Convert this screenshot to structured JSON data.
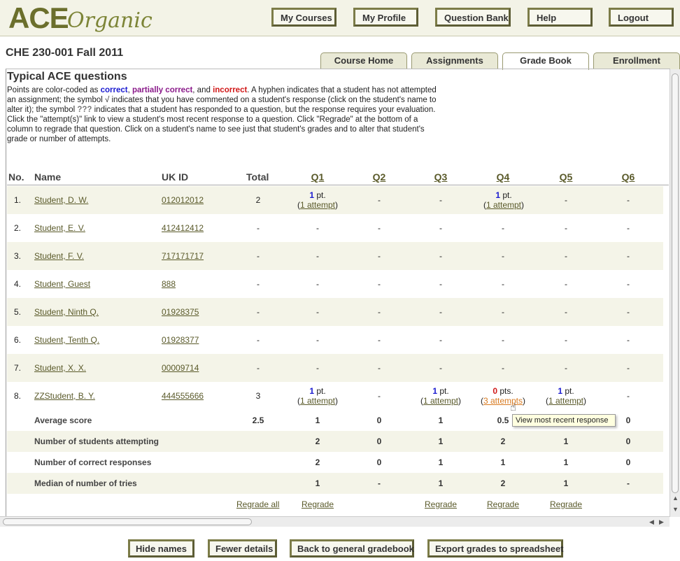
{
  "app": {
    "logo_main": "ACE",
    "logo_sub": "Organic"
  },
  "nav": {
    "my_courses": "My Courses",
    "my_profile": "My Profile",
    "question_bank": "Question Bank",
    "help": "Help",
    "logout": "Logout"
  },
  "course": {
    "title": "CHE 230-001 Fall 2011"
  },
  "tabs": {
    "course_home": "Course Home",
    "assignments": "Assignments",
    "grade_book": "Grade Book",
    "enrollment": "Enrollment"
  },
  "page": {
    "heading": "Typical ACE questions",
    "intro_1": "Points are color-coded as ",
    "correct": "correct",
    "comma": ", ",
    "partial": "partially correct",
    "and": ", and ",
    "incorrect": "incorrect",
    "intro_2": ". A hyphen indicates that a student has not attempted an assignment; the symbol √ indicates that you have commented on a student's response (click on the student's name to alter it); the symbol ",
    "qqq": "???",
    "intro_3": " indicates that a student has responded to a question, but the response requires your evaluation. Click the \"attempt(s)\" link to view a student's most recent response to a question. Click \"Regrade\" at the bottom of a column to regrade that question. Click on a student's name to see just that student's grades and to alter that student's grade or number of attempts."
  },
  "table": {
    "headers": {
      "no": "No.",
      "name": "Name",
      "ukid": "UK ID",
      "total": "Total",
      "q1": "Q1",
      "q2": "Q2",
      "q3": "Q3",
      "q4": "Q4",
      "q5": "Q5",
      "q6": "Q6"
    },
    "rows": [
      {
        "no": "1.",
        "name": "Student, D. W.",
        "ukid": "012012012",
        "total": "2",
        "q1_pts": "1",
        "q1_unit": " pt.",
        "q1_att": "1 attempt",
        "q2": "-",
        "q3": "-",
        "q4_pts": "1",
        "q4_unit": " pt.",
        "q4_att": "1 attempt",
        "q5": "-",
        "q6": "-"
      },
      {
        "no": "2.",
        "name": "Student, E. V.",
        "ukid": "412412412",
        "total": "-",
        "q1": "-",
        "q2": "-",
        "q3": "-",
        "q4": "-",
        "q5": "-",
        "q6": "-"
      },
      {
        "no": "3.",
        "name": "Student, F. V.",
        "ukid": "717171717",
        "total": "-",
        "q1": "-",
        "q2": "-",
        "q3": "-",
        "q4": "-",
        "q5": "-",
        "q6": "-"
      },
      {
        "no": "4.",
        "name": "Student, Guest",
        "ukid": "888",
        "total": "-",
        "q1": "-",
        "q2": "-",
        "q3": "-",
        "q4": "-",
        "q5": "-",
        "q6": "-"
      },
      {
        "no": "5.",
        "name": "Student, Ninth Q.",
        "ukid": "01928375",
        "total": "-",
        "q1": "-",
        "q2": "-",
        "q3": "-",
        "q4": "-",
        "q5": "-",
        "q6": "-"
      },
      {
        "no": "6.",
        "name": "Student, Tenth Q.",
        "ukid": "01928377",
        "total": "-",
        "q1": "-",
        "q2": "-",
        "q3": "-",
        "q4": "-",
        "q5": "-",
        "q6": "-"
      },
      {
        "no": "7.",
        "name": "Student, X. X.",
        "ukid": "00009714",
        "total": "-",
        "q1": "-",
        "q2": "-",
        "q3": "-",
        "q4": "-",
        "q5": "-",
        "q6": "-"
      },
      {
        "no": "8.",
        "name": "ZZStudent, B. Y.",
        "ukid": "444555666",
        "total": "3",
        "q1_pts": "1",
        "q1_unit": " pt.",
        "q1_att": "1 attempt",
        "q2": "-",
        "q3_pts": "1",
        "q3_unit": " pt.",
        "q3_att": "1 attempt",
        "q4_pts": "0",
        "q4_unit": " pts.",
        "q4_att": "3 attempts",
        "q5_pts": "1",
        "q5_unit": " pt.",
        "q5_att": "1 attempt",
        "q6": "-"
      }
    ],
    "stats": [
      {
        "label": "Average score",
        "total": "2.5",
        "q1": "1",
        "q2": "0",
        "q3": "1",
        "q4": "0.5",
        "q5": "",
        "q6": "0"
      },
      {
        "label": "Number of students attempting",
        "total": "",
        "q1": "2",
        "q2": "0",
        "q3": "1",
        "q4": "2",
        "q5": "1",
        "q6": "0"
      },
      {
        "label": "Number of correct responses",
        "total": "",
        "q1": "2",
        "q2": "0",
        "q3": "1",
        "q4": "1",
        "q5": "1",
        "q6": "0"
      },
      {
        "label": "Median of number of tries",
        "total": "",
        "q1": "1",
        "q2": "-",
        "q3": "1",
        "q4": "2",
        "q5": "1",
        "q6": "-"
      }
    ],
    "regrade": {
      "all": "Regrade all",
      "q1": "Regrade",
      "q3": "Regrade",
      "q4": "Regrade",
      "q5": "Regrade"
    },
    "tooltip": "View most recent response"
  },
  "buttons": {
    "hide_names": "Hide names",
    "fewer_details": "Fewer details",
    "back": "Back to general gradebook",
    "export": "Export grades to spreadsheet"
  },
  "colors": {
    "accent": "#7c7c48",
    "correct": "#1a1ad0",
    "partial": "#8a1a8a",
    "incorrect": "#d01818",
    "row_stripe": "#f4f4e8"
  }
}
